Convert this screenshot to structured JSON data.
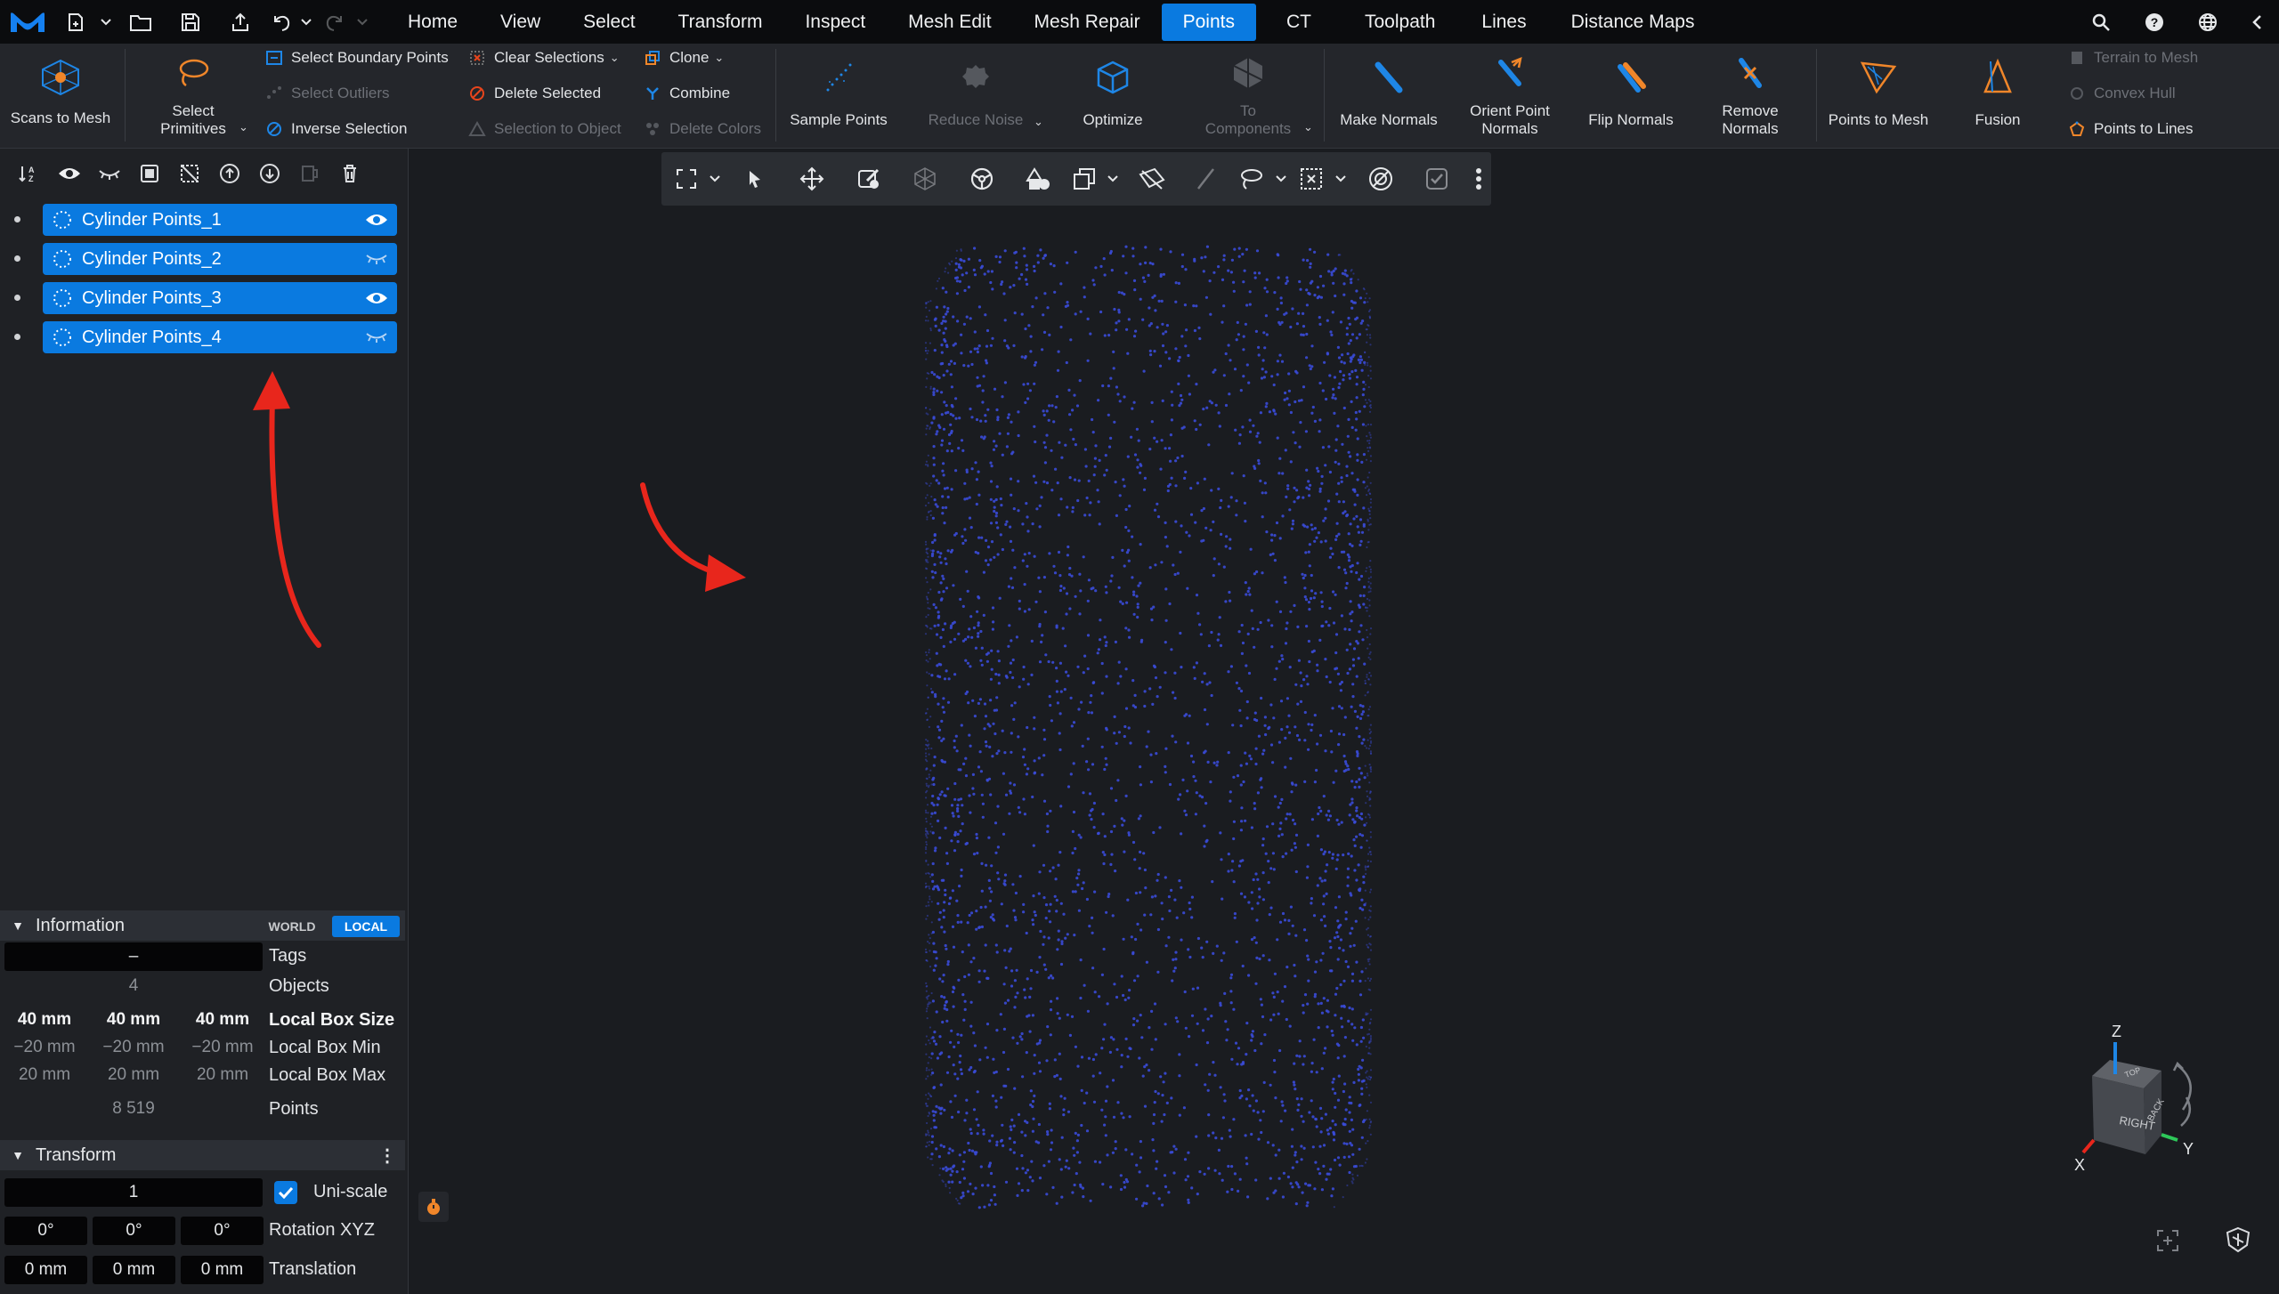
{
  "menubar": {
    "tabs": [
      "Home",
      "View",
      "Select",
      "Transform",
      "Inspect",
      "Mesh Edit",
      "Mesh Repair",
      "Points",
      "CT",
      "Toolpath",
      "Lines",
      "Distance Maps"
    ],
    "active_tab": "Points",
    "right_icons": [
      "search-icon",
      "help-icon",
      "globe-icon",
      "collapse-icon"
    ]
  },
  "ribbon": {
    "scans_to_mesh": "Scans to Mesh",
    "select_primitives": "Select\nPrimitives",
    "select_boundary_points": "Select Boundary Points",
    "select_outliers": "Select Outliers",
    "inverse_selection": "Inverse Selection",
    "clear_selections": "Clear Selections",
    "delete_selected": "Delete Selected",
    "selection_to_object": "Selection to Object",
    "clone": "Clone",
    "combine": "Combine",
    "delete_colors": "Delete Colors",
    "sample_points": "Sample Points",
    "reduce_noise": "Reduce Noise",
    "optimize": "Optimize",
    "to_components": "To\nComponents",
    "make_normals": "Make Normals",
    "orient_point_normals": "Orient Point\nNormals",
    "flip_normals": "Flip Normals",
    "remove_normals": "Remove\nNormals",
    "points_to_mesh": "Points to Mesh",
    "fusion": "Fusion",
    "terrain_to_mesh": "Terrain to Mesh",
    "convex_hull": "Convex Hull",
    "points_to_lines": "Points to Lines"
  },
  "objects": [
    {
      "label": "Cylinder Points_1",
      "visible": true
    },
    {
      "label": "Cylinder Points_2",
      "visible": false
    },
    {
      "label": "Cylinder Points_3",
      "visible": true
    },
    {
      "label": "Cylinder Points_4",
      "visible": false
    }
  ],
  "information": {
    "title": "Information",
    "world": "WORLD",
    "local": "LOCAL",
    "tags_value": "–",
    "tags_label": "Tags",
    "objects_value": "4",
    "objects_label": "Objects",
    "box_size": [
      "40 mm",
      "40 mm",
      "40 mm"
    ],
    "box_size_label": "Local Box Size",
    "box_min": [
      "−20 mm",
      "−20 mm",
      "−20 mm"
    ],
    "box_min_label": "Local Box Min",
    "box_max": [
      "20 mm",
      "20 mm",
      "20 mm"
    ],
    "box_max_label": "Local Box Max",
    "points_value": "8 519",
    "points_label": "Points"
  },
  "transform": {
    "title": "Transform",
    "scale_value": "1",
    "uniscale_label": "Uni-scale",
    "rotation": [
      "0°",
      "0°",
      "0°"
    ],
    "rotation_label": "Rotation XYZ",
    "translation": [
      "0 mm",
      "0 mm",
      "0 mm"
    ],
    "translation_label": "Translation"
  },
  "viewcube": {
    "z": "Z",
    "x": "X",
    "y": "Y",
    "right": "RIGHT",
    "back": "BACK",
    "top": "TOP"
  },
  "colors": {
    "accent": "#0a7ae0",
    "annotation_arrow": "#e8261c",
    "points": "#3a4bd8"
  }
}
